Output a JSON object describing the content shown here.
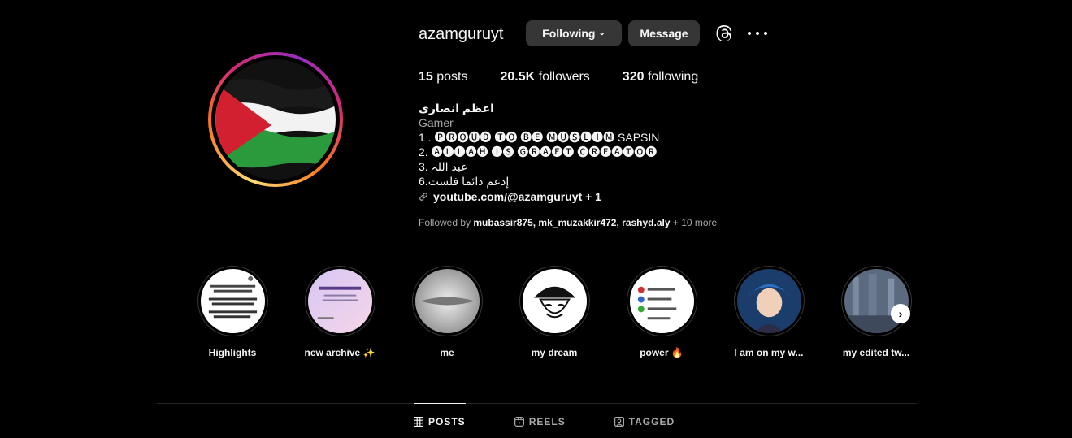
{
  "profile": {
    "username": "azamguruyt",
    "following_label": "Following",
    "message_label": "Message"
  },
  "stats": {
    "posts_count": "15",
    "posts_label": "posts",
    "followers_count": "20.5K",
    "followers_label": "followers",
    "following_count": "320",
    "following_label": "following"
  },
  "bio": {
    "name": "اعظم انصاری",
    "category": "Gamer",
    "lines": [
      "1 . 🅟🅡🅞🅤🅓 🅣🅞 🅑🅔 🅜🅤🅢🅛🅘🅜 SAPSIN",
      "2. 🅐🅛🅛🅐🅗 🅘🅢 🅖🅡🅐🅔🅣 🅒🅡🅔🅐🅣🅞🅡",
      "3. عبد اللہ",
      "6.إدعم دائما فلست"
    ],
    "link": "youtube.com/@azamguruyt + 1"
  },
  "followed_by": {
    "prefix": "Followed by ",
    "users": "mubassir875, mk_muzakkir472, rashyd.aly",
    "more": " + 10 more"
  },
  "highlights": [
    {
      "label": "Highlights"
    },
    {
      "label": "new archive ✨"
    },
    {
      "label": "me"
    },
    {
      "label": "my dream"
    },
    {
      "label": "power 🔥"
    },
    {
      "label": "I am on my w..."
    },
    {
      "label": "my edited tw..."
    }
  ],
  "tabs": [
    {
      "label": "POSTS",
      "active": true
    },
    {
      "label": "REELS",
      "active": false
    },
    {
      "label": "TAGGED",
      "active": false
    }
  ],
  "icons": {
    "threads": "threads-icon",
    "more": "more-options-icon",
    "link": "link-icon",
    "next": "chevron-right-icon"
  }
}
